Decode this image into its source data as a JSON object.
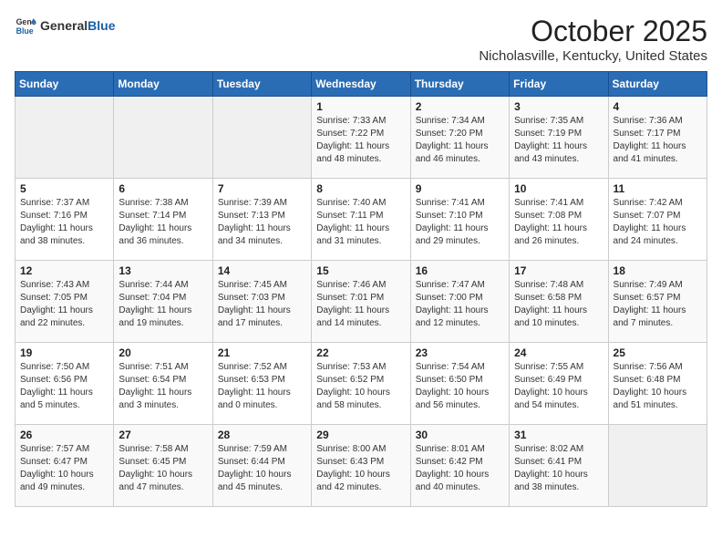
{
  "header": {
    "logo_general": "General",
    "logo_blue": "Blue",
    "month_title": "October 2025",
    "location": "Nicholasville, Kentucky, United States"
  },
  "days_of_week": [
    "Sunday",
    "Monday",
    "Tuesday",
    "Wednesday",
    "Thursday",
    "Friday",
    "Saturday"
  ],
  "weeks": [
    [
      {
        "day": "",
        "info": ""
      },
      {
        "day": "",
        "info": ""
      },
      {
        "day": "",
        "info": ""
      },
      {
        "day": "1",
        "info": "Sunrise: 7:33 AM\nSunset: 7:22 PM\nDaylight: 11 hours\nand 48 minutes."
      },
      {
        "day": "2",
        "info": "Sunrise: 7:34 AM\nSunset: 7:20 PM\nDaylight: 11 hours\nand 46 minutes."
      },
      {
        "day": "3",
        "info": "Sunrise: 7:35 AM\nSunset: 7:19 PM\nDaylight: 11 hours\nand 43 minutes."
      },
      {
        "day": "4",
        "info": "Sunrise: 7:36 AM\nSunset: 7:17 PM\nDaylight: 11 hours\nand 41 minutes."
      }
    ],
    [
      {
        "day": "5",
        "info": "Sunrise: 7:37 AM\nSunset: 7:16 PM\nDaylight: 11 hours\nand 38 minutes."
      },
      {
        "day": "6",
        "info": "Sunrise: 7:38 AM\nSunset: 7:14 PM\nDaylight: 11 hours\nand 36 minutes."
      },
      {
        "day": "7",
        "info": "Sunrise: 7:39 AM\nSunset: 7:13 PM\nDaylight: 11 hours\nand 34 minutes."
      },
      {
        "day": "8",
        "info": "Sunrise: 7:40 AM\nSunset: 7:11 PM\nDaylight: 11 hours\nand 31 minutes."
      },
      {
        "day": "9",
        "info": "Sunrise: 7:41 AM\nSunset: 7:10 PM\nDaylight: 11 hours\nand 29 minutes."
      },
      {
        "day": "10",
        "info": "Sunrise: 7:41 AM\nSunset: 7:08 PM\nDaylight: 11 hours\nand 26 minutes."
      },
      {
        "day": "11",
        "info": "Sunrise: 7:42 AM\nSunset: 7:07 PM\nDaylight: 11 hours\nand 24 minutes."
      }
    ],
    [
      {
        "day": "12",
        "info": "Sunrise: 7:43 AM\nSunset: 7:05 PM\nDaylight: 11 hours\nand 22 minutes."
      },
      {
        "day": "13",
        "info": "Sunrise: 7:44 AM\nSunset: 7:04 PM\nDaylight: 11 hours\nand 19 minutes."
      },
      {
        "day": "14",
        "info": "Sunrise: 7:45 AM\nSunset: 7:03 PM\nDaylight: 11 hours\nand 17 minutes."
      },
      {
        "day": "15",
        "info": "Sunrise: 7:46 AM\nSunset: 7:01 PM\nDaylight: 11 hours\nand 14 minutes."
      },
      {
        "day": "16",
        "info": "Sunrise: 7:47 AM\nSunset: 7:00 PM\nDaylight: 11 hours\nand 12 minutes."
      },
      {
        "day": "17",
        "info": "Sunrise: 7:48 AM\nSunset: 6:58 PM\nDaylight: 11 hours\nand 10 minutes."
      },
      {
        "day": "18",
        "info": "Sunrise: 7:49 AM\nSunset: 6:57 PM\nDaylight: 11 hours\nand 7 minutes."
      }
    ],
    [
      {
        "day": "19",
        "info": "Sunrise: 7:50 AM\nSunset: 6:56 PM\nDaylight: 11 hours\nand 5 minutes."
      },
      {
        "day": "20",
        "info": "Sunrise: 7:51 AM\nSunset: 6:54 PM\nDaylight: 11 hours\nand 3 minutes."
      },
      {
        "day": "21",
        "info": "Sunrise: 7:52 AM\nSunset: 6:53 PM\nDaylight: 11 hours\nand 0 minutes."
      },
      {
        "day": "22",
        "info": "Sunrise: 7:53 AM\nSunset: 6:52 PM\nDaylight: 10 hours\nand 58 minutes."
      },
      {
        "day": "23",
        "info": "Sunrise: 7:54 AM\nSunset: 6:50 PM\nDaylight: 10 hours\nand 56 minutes."
      },
      {
        "day": "24",
        "info": "Sunrise: 7:55 AM\nSunset: 6:49 PM\nDaylight: 10 hours\nand 54 minutes."
      },
      {
        "day": "25",
        "info": "Sunrise: 7:56 AM\nSunset: 6:48 PM\nDaylight: 10 hours\nand 51 minutes."
      }
    ],
    [
      {
        "day": "26",
        "info": "Sunrise: 7:57 AM\nSunset: 6:47 PM\nDaylight: 10 hours\nand 49 minutes."
      },
      {
        "day": "27",
        "info": "Sunrise: 7:58 AM\nSunset: 6:45 PM\nDaylight: 10 hours\nand 47 minutes."
      },
      {
        "day": "28",
        "info": "Sunrise: 7:59 AM\nSunset: 6:44 PM\nDaylight: 10 hours\nand 45 minutes."
      },
      {
        "day": "29",
        "info": "Sunrise: 8:00 AM\nSunset: 6:43 PM\nDaylight: 10 hours\nand 42 minutes."
      },
      {
        "day": "30",
        "info": "Sunrise: 8:01 AM\nSunset: 6:42 PM\nDaylight: 10 hours\nand 40 minutes."
      },
      {
        "day": "31",
        "info": "Sunrise: 8:02 AM\nSunset: 6:41 PM\nDaylight: 10 hours\nand 38 minutes."
      },
      {
        "day": "",
        "info": ""
      }
    ]
  ]
}
